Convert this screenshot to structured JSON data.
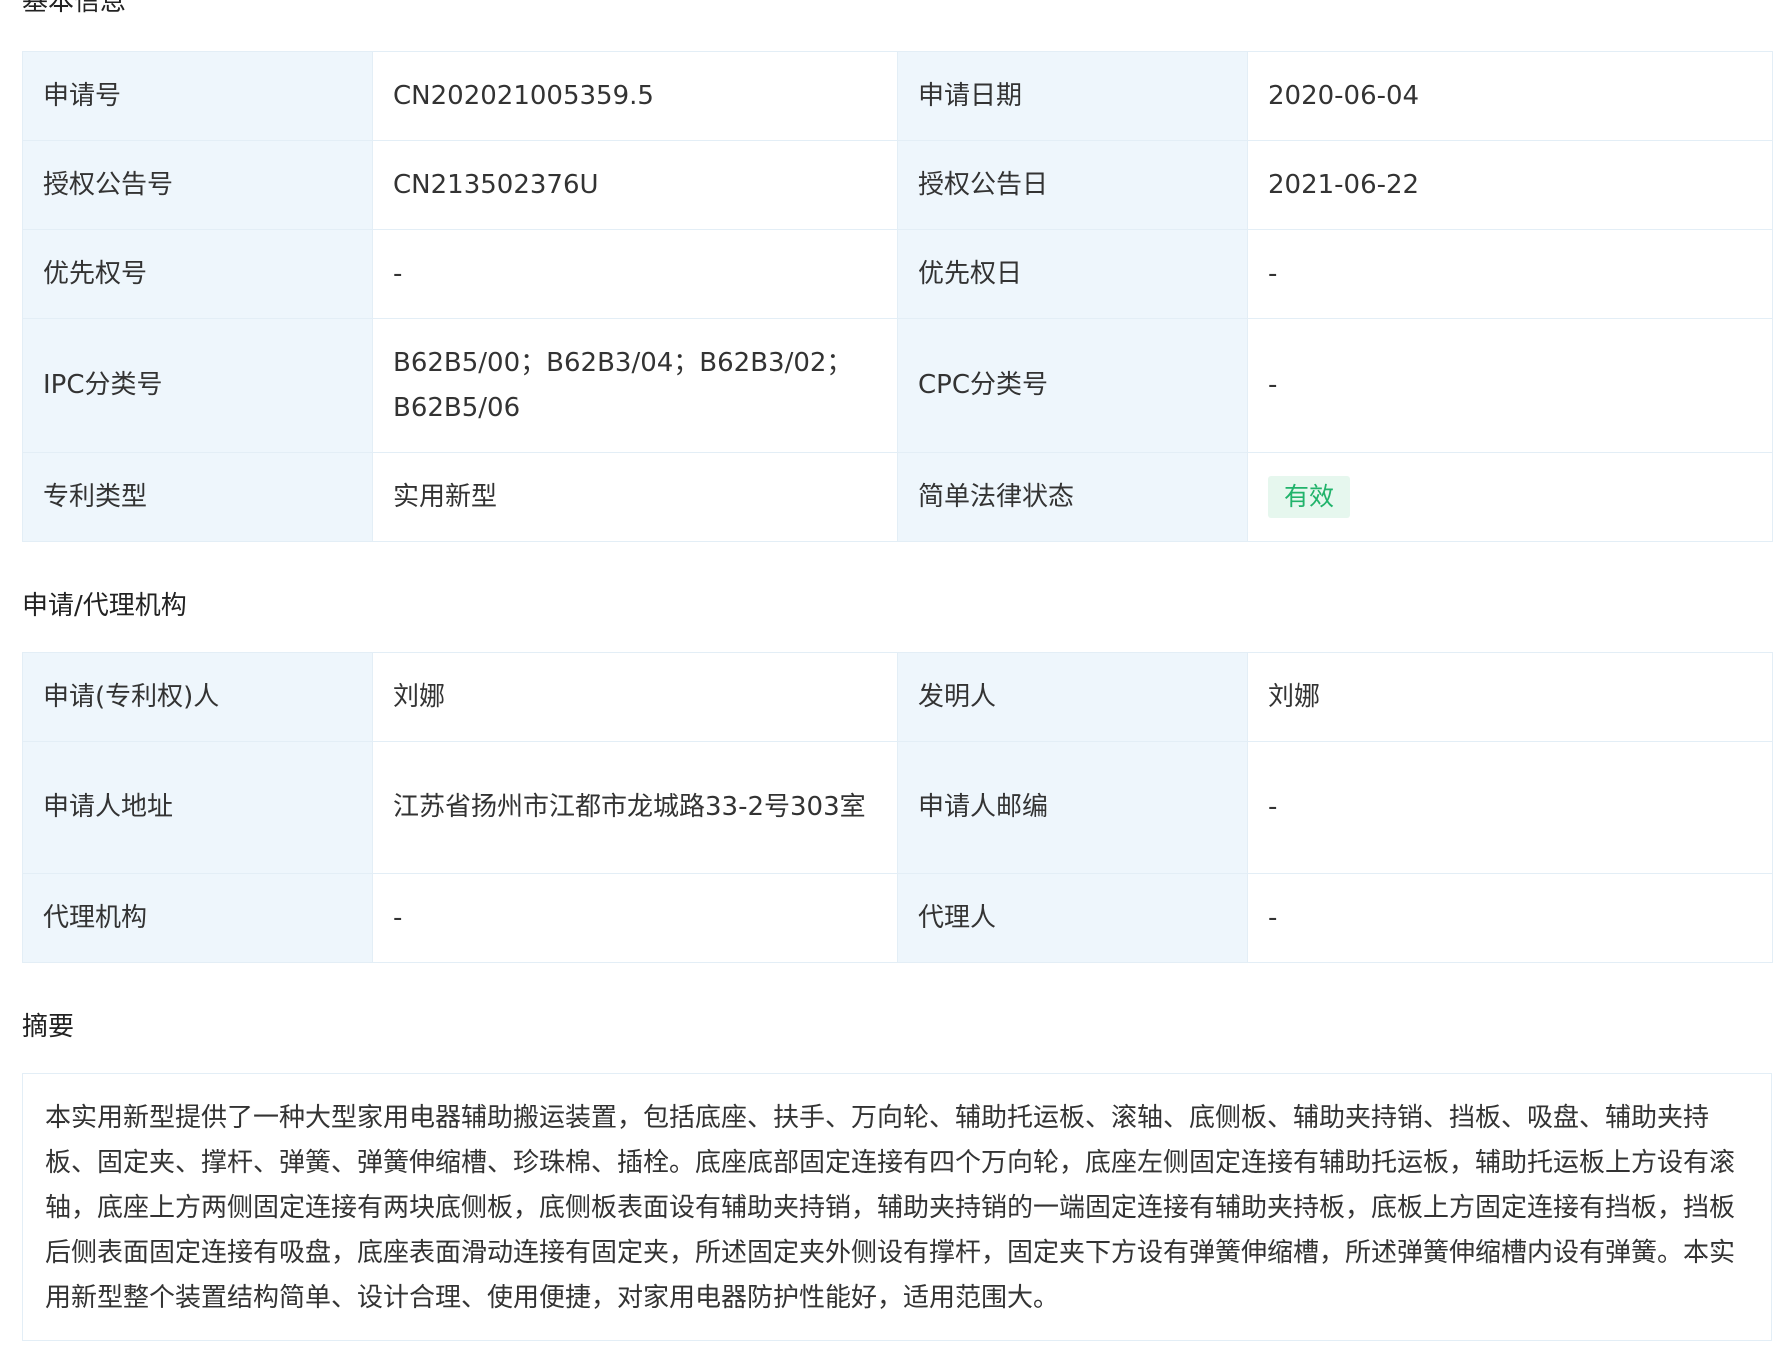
{
  "sections": {
    "basic_info": "基本信息",
    "agency": "申请/代理机构",
    "abstract": "摘要"
  },
  "basic_info": {
    "rows": [
      [
        "申请号",
        "CN202021005359.5",
        "申请日期",
        "2020-06-04"
      ],
      [
        "授权公告号",
        "CN213502376U",
        "授权公告日",
        "2021-06-22"
      ],
      [
        "优先权号",
        "-",
        "优先权日",
        "-"
      ],
      [
        "IPC分类号",
        "B62B5/00；B62B3/04；B62B3/02；B62B5/06",
        "CPC分类号",
        "-"
      ],
      [
        "专利类型",
        "实用新型",
        "简单法律状态",
        "有效"
      ]
    ],
    "status_color": "#21b36b"
  },
  "agency": {
    "rows": [
      [
        "申请(专利权)人",
        "刘娜",
        "发明人",
        "刘娜"
      ],
      [
        "申请人地址",
        "江苏省扬州市江都市龙城路33-2号303室",
        "申请人邮编",
        "-"
      ],
      [
        "代理机构",
        "-",
        "代理人",
        "-"
      ]
    ]
  },
  "abstract": {
    "text": "本实用新型提供了一种大型家用电器辅助搬运装置，包括底座、扶手、万向轮、辅助托运板、滚轴、底侧板、辅助夹持销、挡板、吸盘、辅助夹持板、固定夹、撑杆、弹簧、弹簧伸缩槽、珍珠棉、插栓。底座底部固定连接有四个万向轮，底座左侧固定连接有辅助托运板，辅助托运板上方设有滚轴，底座上方两侧固定连接有两块底侧板，底侧板表面设有辅助夹持销，辅助夹持销的一端固定连接有辅助夹持板，底板上方固定连接有挡板，挡板后侧表面固定连接有吸盘，底座表面滑动连接有固定夹，所述固定夹外侧设有撑杆，固定夹下方设有弹簧伸缩槽，所述弹簧伸缩槽内设有弹簧。本实用新型整个装置结构简单、设计合理、使用便捷，对家用电器防护性能好，适用范围大。"
  }
}
